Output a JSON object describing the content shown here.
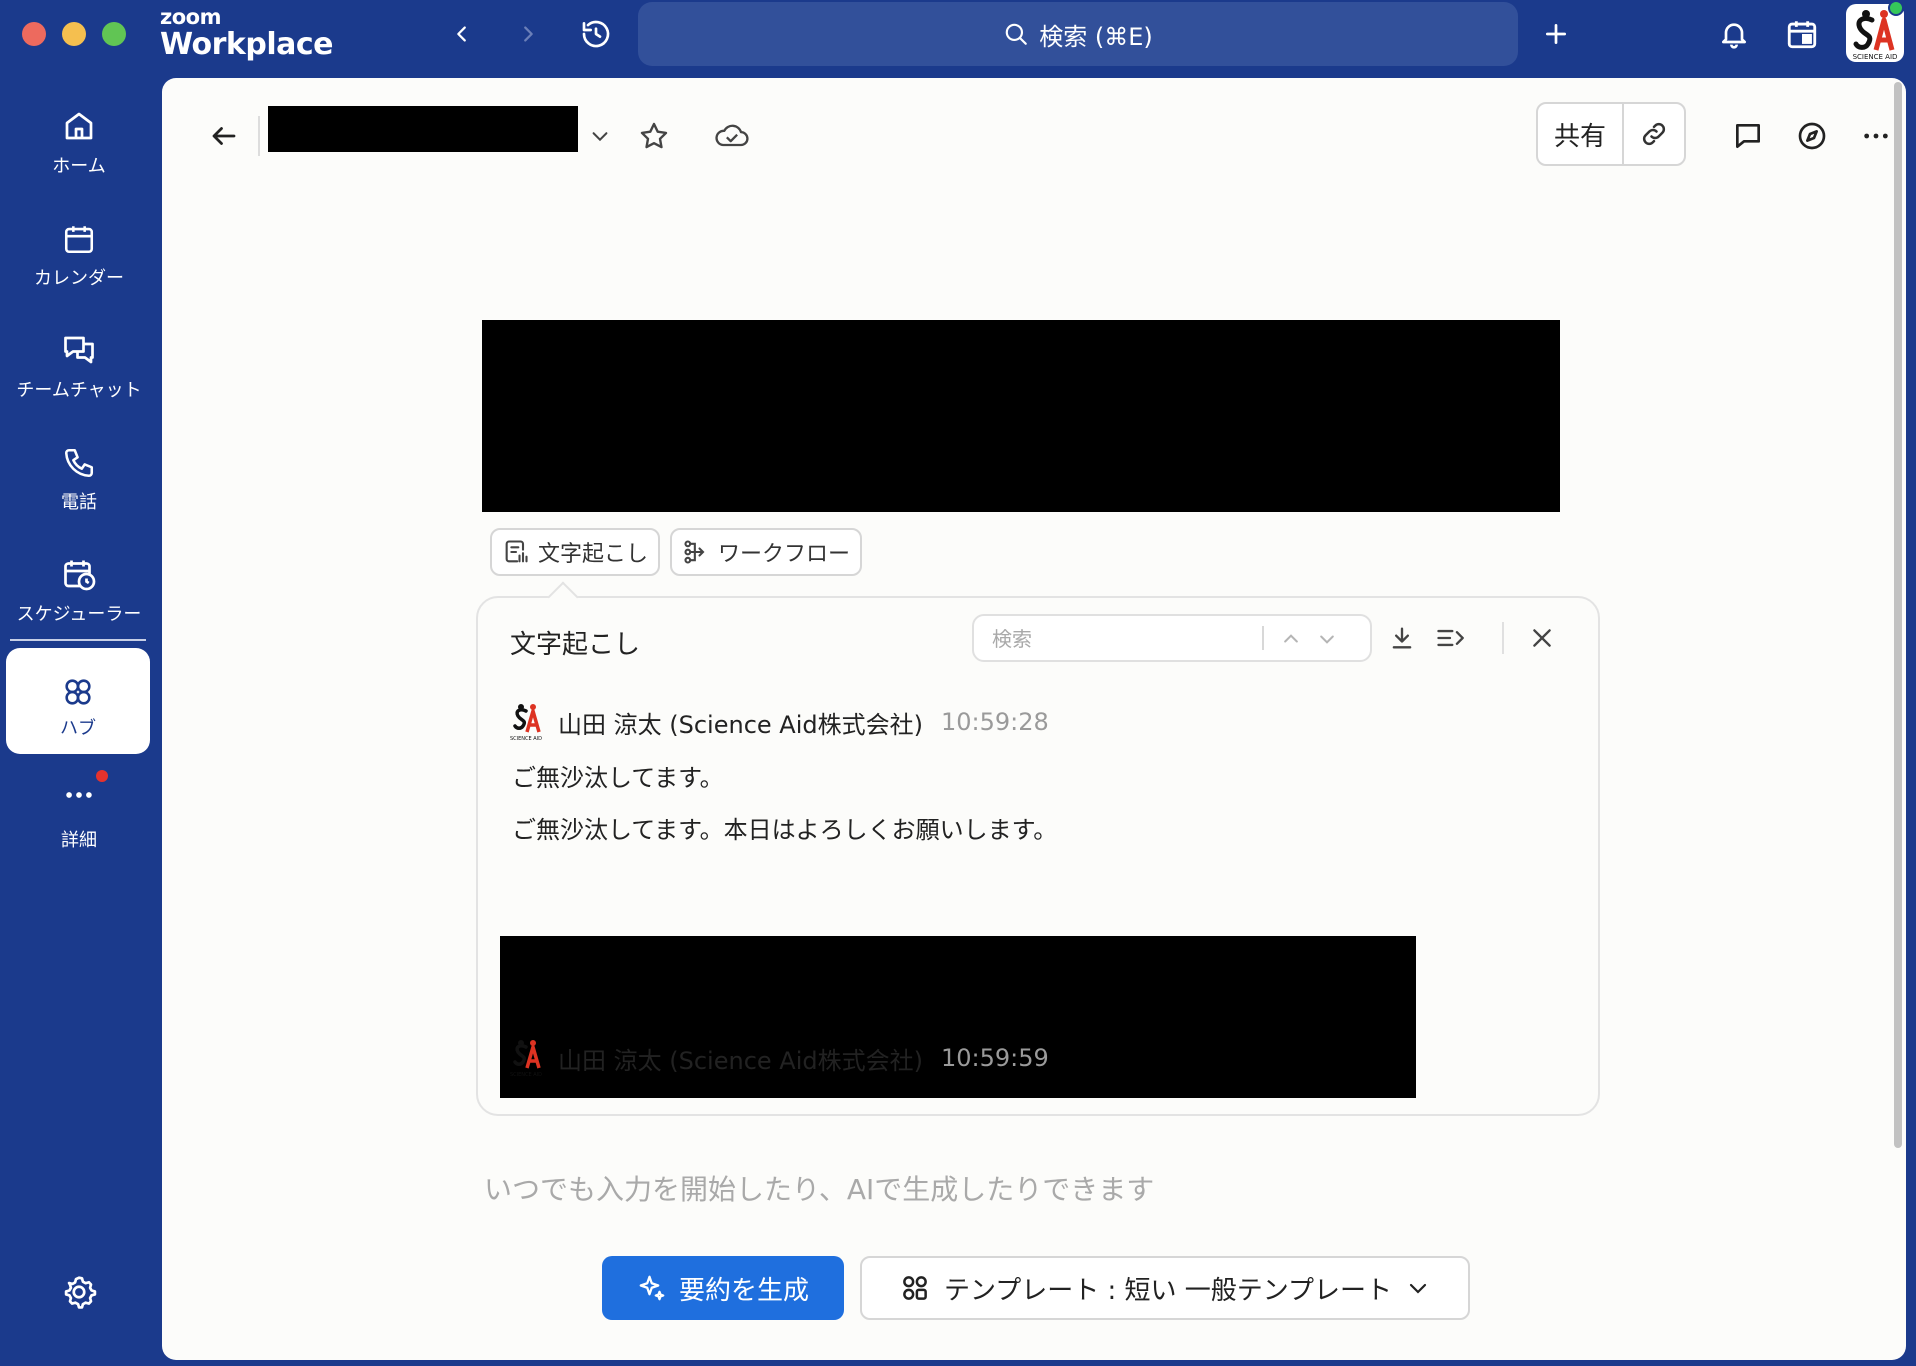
{
  "window": {
    "brand_small": "zoom",
    "brand_large": "Workplace",
    "search_label": "検索 (⌘E)"
  },
  "sidebar": {
    "items": [
      {
        "label": "ホーム",
        "icon": "home-icon"
      },
      {
        "label": "カレンダー",
        "icon": "calendar-icon"
      },
      {
        "label": "チームチャット",
        "icon": "chat-icon"
      },
      {
        "label": "電話",
        "icon": "phone-icon"
      },
      {
        "label": "スケジューラー",
        "icon": "scheduler-icon"
      },
      {
        "label": "ハブ",
        "icon": "hub-icon",
        "active": true
      },
      {
        "label": "詳細",
        "icon": "more-icon",
        "badge": true
      }
    ],
    "settings_icon": "gear-icon"
  },
  "doc_header": {
    "share_label": "共有"
  },
  "pills": {
    "transcript_label": "文字起こし",
    "workflow_label": "ワークフロー"
  },
  "transcript": {
    "title": "文字起こし",
    "search_placeholder": "検索",
    "entries": [
      {
        "speaker": "山田 涼太 (Science Aid株式会社)",
        "time": "10:59:28",
        "lines": [
          "ご無沙汰してます。",
          "ご無沙汰してます。本日はよろしくお願いします。"
        ]
      },
      {
        "speaker": "山田 涼太 (Science Aid株式会社)",
        "time": "10:59:59",
        "lines": []
      }
    ]
  },
  "editor": {
    "placeholder": "いつでも入力を開始したり、AIで生成したりできます"
  },
  "footer": {
    "generate_label": "要約を生成",
    "template_label": "テンプレート : 短い 一般テンプレート"
  },
  "colors": {
    "sidebar_bg": "#1b3a8c",
    "primary_button": "#1f6fde",
    "badge_red": "#e5322d",
    "online_green": "#35c759"
  }
}
